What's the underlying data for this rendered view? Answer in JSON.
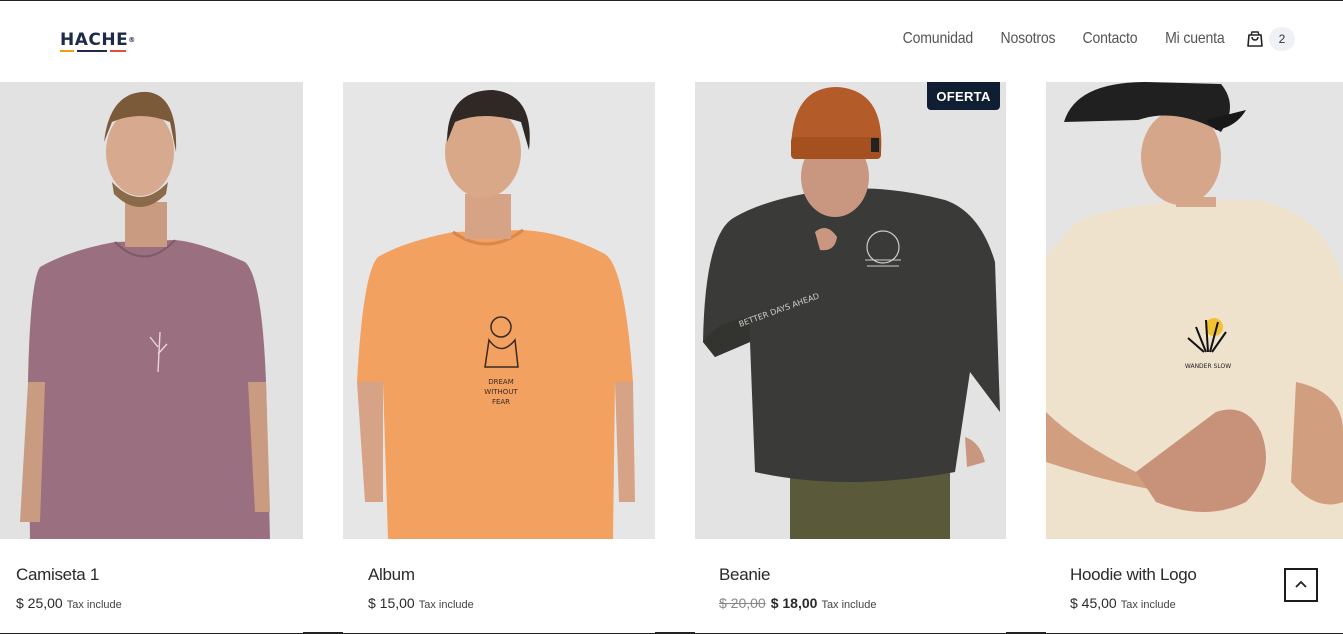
{
  "brand": {
    "name": "HACHE",
    "mark": "®",
    "colors": [
      "#1e2a4a",
      "#f39c12",
      "#e74c3c"
    ]
  },
  "nav": {
    "links": [
      "Comunidad",
      "Nosotros",
      "Contacto",
      "Mi cuenta"
    ],
    "cart_icon": "shopping-bag-icon",
    "cart_count": "2"
  },
  "products": [
    {
      "name": "Camiseta 1",
      "price": "$ 25,00",
      "tax": "Tax include",
      "image": "model-in-mauve-tshirt",
      "shirt_color": "#9a6f7f"
    },
    {
      "name": "Album",
      "price": "$ 15,00",
      "tax": "Tax include",
      "image": "model-in-orange-tshirt",
      "shirt_color": "#f2a161"
    },
    {
      "name": "Beanie",
      "old_price": "$ 20,00",
      "price": "$ 18,00",
      "tax": "Tax include",
      "badge": "OFERTA",
      "image": "model-in-dark-sweatshirt-and-beanie",
      "shirt_color": "#3a3a38"
    },
    {
      "name": "Hoodie with Logo",
      "price": "$ 45,00",
      "tax": "Tax include",
      "image": "model-in-cream-tshirt-and-cap",
      "shirt_color": "#efe2cd"
    }
  ],
  "scroll_top_icon": "chevron-up-icon"
}
